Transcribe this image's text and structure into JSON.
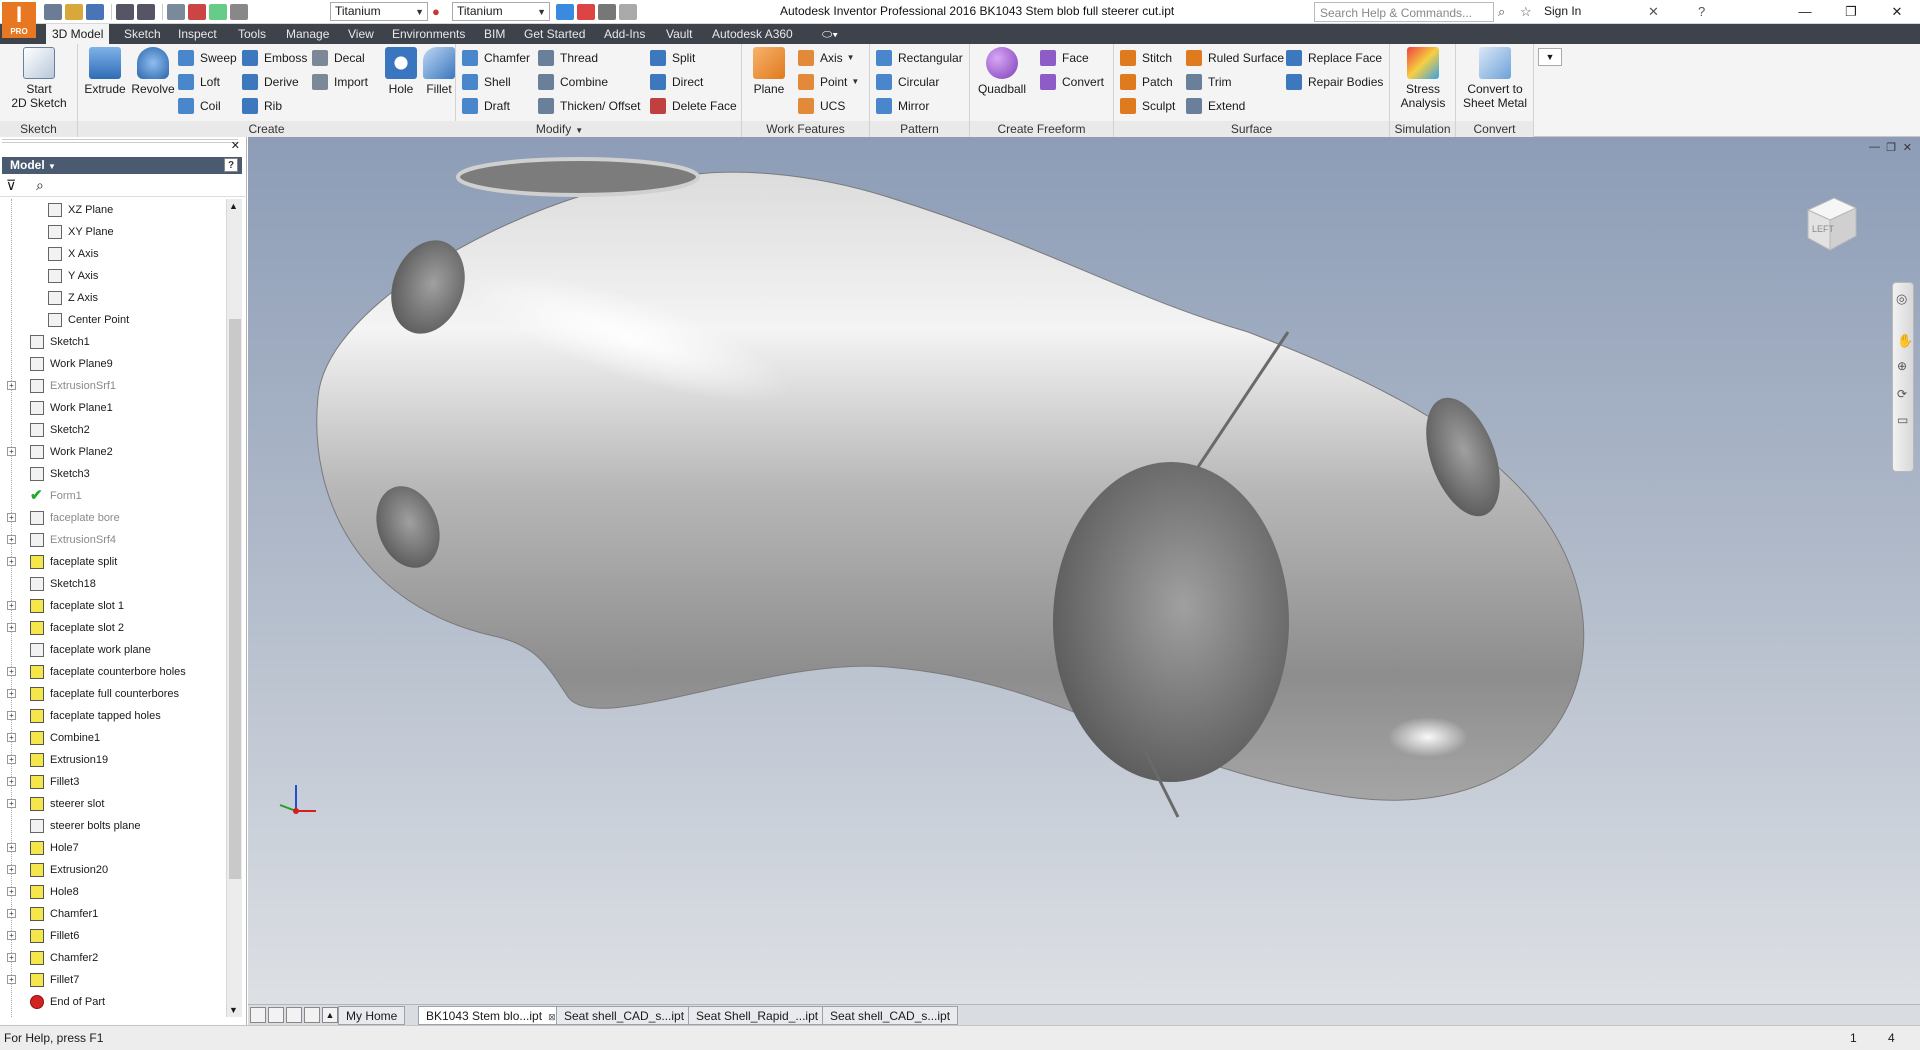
{
  "titlebar": {
    "title": "Autodesk Inventor Professional 2016    BK1043 Stem blob full steerer cut.ipt",
    "material": "Titanium",
    "appearance": "Titanium",
    "search_placeholder": "Search Help & Commands...",
    "signin": "Sign In",
    "logo_letter": "I",
    "logo_badge": "PRO"
  },
  "ribbon_tabs": [
    "3D Model",
    "Sketch",
    "Inspect",
    "Tools",
    "Manage",
    "View",
    "Environments",
    "BIM",
    "Get Started",
    "Add-Ins",
    "Vault",
    "Autodesk A360"
  ],
  "ribbon": {
    "sketch": {
      "title": "Sketch",
      "start": "Start",
      "start2": "2D Sketch"
    },
    "create": {
      "title": "Create",
      "extrude": "Extrude",
      "revolve": "Revolve",
      "sweep": "Sweep",
      "loft": "Loft",
      "coil": "Coil",
      "emboss": "Emboss",
      "derive": "Derive",
      "rib": "Rib",
      "decal": "Decal",
      "import": "Import"
    },
    "modify": {
      "title": "Modify",
      "hole": "Hole",
      "fillet": "Fillet",
      "chamfer": "Chamfer",
      "shell": "Shell",
      "draft": "Draft",
      "thread": "Thread",
      "combine": "Combine",
      "thicken": "Thicken/ Offset",
      "split": "Split",
      "direct": "Direct",
      "delete_face": "Delete Face"
    },
    "work_features": {
      "title": "Work Features",
      "plane": "Plane",
      "axis": "Axis",
      "point": "Point",
      "ucs": "UCS"
    },
    "pattern": {
      "title": "Pattern",
      "rectangular": "Rectangular",
      "circular": "Circular",
      "mirror": "Mirror"
    },
    "freeform": {
      "title": "Create Freeform",
      "quadball": "Quadball",
      "face": "Face",
      "convert": "Convert"
    },
    "surface": {
      "title": "Surface",
      "stitch": "Stitch",
      "patch": "Patch",
      "sculpt": "Sculpt",
      "ruled": "Ruled Surface",
      "trim": "Trim",
      "extend": "Extend",
      "replace": "Replace Face",
      "repair": "Repair Bodies"
    },
    "simulation": {
      "title": "Simulation",
      "stress1": "Stress",
      "stress2": "Analysis"
    },
    "convert": {
      "title": "Convert",
      "c1": "Convert to",
      "c2": "Sheet Metal"
    }
  },
  "browser": {
    "title": "Model",
    "help": "?",
    "nodes": [
      {
        "label": "XZ Plane",
        "indent": 2,
        "icon": "plane",
        "expand": false,
        "dim": false
      },
      {
        "label": "XY Plane",
        "indent": 2,
        "icon": "plane",
        "expand": false,
        "dim": false
      },
      {
        "label": "X Axis",
        "indent": 2,
        "icon": "axis",
        "expand": false,
        "dim": false
      },
      {
        "label": "Y Axis",
        "indent": 2,
        "icon": "axis",
        "expand": false,
        "dim": false
      },
      {
        "label": "Z Axis",
        "indent": 2,
        "icon": "axis",
        "expand": false,
        "dim": false
      },
      {
        "label": "Center Point",
        "indent": 2,
        "icon": "point",
        "expand": false,
        "dim": false
      },
      {
        "label": "Sketch1",
        "indent": 1,
        "icon": "sketch",
        "expand": false,
        "dim": false
      },
      {
        "label": "Work Plane9",
        "indent": 1,
        "icon": "plane",
        "expand": false,
        "dim": false
      },
      {
        "label": "ExtrusionSrf1",
        "indent": 1,
        "icon": "plane",
        "expand": true,
        "dim": true
      },
      {
        "label": "Work Plane1",
        "indent": 1,
        "icon": "plane",
        "expand": false,
        "dim": false
      },
      {
        "label": "Sketch2",
        "indent": 1,
        "icon": "sketch",
        "expand": false,
        "dim": false
      },
      {
        "label": "Work Plane2",
        "indent": 1,
        "icon": "plane",
        "expand": true,
        "dim": false
      },
      {
        "label": "Sketch3",
        "indent": 1,
        "icon": "sketch",
        "expand": false,
        "dim": false
      },
      {
        "label": "Form1",
        "indent": 1,
        "icon": "check",
        "expand": false,
        "dim": true
      },
      {
        "label": "faceplate bore",
        "indent": 1,
        "icon": "plane",
        "expand": true,
        "dim": true
      },
      {
        "label": "ExtrusionSrf4",
        "indent": 1,
        "icon": "plane",
        "expand": true,
        "dim": true
      },
      {
        "label": "faceplate split",
        "indent": 1,
        "icon": "feat",
        "expand": true,
        "dim": false
      },
      {
        "label": "Sketch18",
        "indent": 1,
        "icon": "sketch",
        "expand": false,
        "dim": false
      },
      {
        "label": "faceplate slot 1",
        "indent": 1,
        "icon": "feat",
        "expand": true,
        "dim": false
      },
      {
        "label": "faceplate slot 2",
        "indent": 1,
        "icon": "feat",
        "expand": true,
        "dim": false
      },
      {
        "label": "faceplate work plane",
        "indent": 1,
        "icon": "plane",
        "expand": false,
        "dim": false
      },
      {
        "label": "faceplate counterbore holes",
        "indent": 1,
        "icon": "feat",
        "expand": true,
        "dim": false
      },
      {
        "label": "faceplate full counterbores",
        "indent": 1,
        "icon": "feat",
        "expand": true,
        "dim": false
      },
      {
        "label": "faceplate tapped holes",
        "indent": 1,
        "icon": "feat",
        "expand": true,
        "dim": false
      },
      {
        "label": "Combine1",
        "indent": 1,
        "icon": "feat",
        "expand": true,
        "dim": false
      },
      {
        "label": "Extrusion19",
        "indent": 1,
        "icon": "feat",
        "expand": true,
        "dim": false
      },
      {
        "label": "Fillet3",
        "indent": 1,
        "icon": "feat",
        "expand": true,
        "dim": false
      },
      {
        "label": "steerer slot",
        "indent": 1,
        "icon": "feat",
        "expand": true,
        "dim": false
      },
      {
        "label": "steerer bolts plane",
        "indent": 1,
        "icon": "plane",
        "expand": false,
        "dim": false
      },
      {
        "label": "Hole7",
        "indent": 1,
        "icon": "feat",
        "expand": true,
        "dim": false
      },
      {
        "label": "Extrusion20",
        "indent": 1,
        "icon": "feat",
        "expand": true,
        "dim": false
      },
      {
        "label": "Hole8",
        "indent": 1,
        "icon": "feat",
        "expand": true,
        "dim": false
      },
      {
        "label": "Chamfer1",
        "indent": 1,
        "icon": "feat",
        "expand": true,
        "dim": false
      },
      {
        "label": "Fillet6",
        "indent": 1,
        "icon": "feat",
        "expand": true,
        "dim": false
      },
      {
        "label": "Chamfer2",
        "indent": 1,
        "icon": "feat",
        "expand": true,
        "dim": false
      },
      {
        "label": "Fillet7",
        "indent": 1,
        "icon": "feat",
        "expand": true,
        "dim": false
      },
      {
        "label": "End of Part",
        "indent": 1,
        "icon": "end",
        "expand": false,
        "dim": false
      }
    ]
  },
  "viewcube": {
    "label": "LEFT"
  },
  "doc_tabs": [
    {
      "label": "My Home",
      "active": false,
      "closable": false
    },
    {
      "label": "BK1043 Stem blo...ipt",
      "active": true,
      "closable": true
    },
    {
      "label": "Seat shell_CAD_s...ipt",
      "active": false,
      "closable": false
    },
    {
      "label": "Seat Shell_Rapid_...ipt",
      "active": false,
      "closable": false
    },
    {
      "label": "Seat shell_CAD_s...ipt",
      "active": false,
      "closable": false
    }
  ],
  "statusbar": {
    "help": "For Help, press F1",
    "count1": "1",
    "count2": "4"
  },
  "colors": {
    "accent": "#e87722",
    "ribbon_dark": "#3e434b",
    "browser_header": "#4a5a70"
  }
}
